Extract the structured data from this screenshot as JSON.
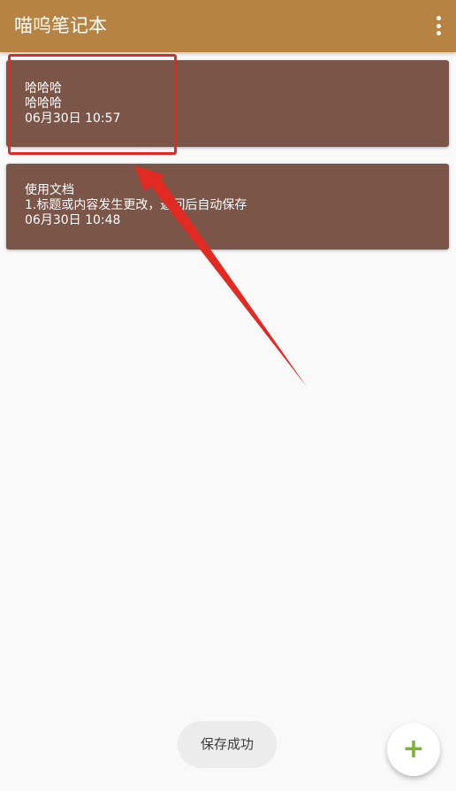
{
  "app_bar": {
    "title": "喵呜笔记本",
    "menu_icon": "more-vert-icon",
    "background": "#b68342"
  },
  "notes": [
    {
      "title": "哈哈哈",
      "content": "哈哈哈",
      "time": "06月30日 10:57"
    },
    {
      "title": "使用文档",
      "content": "1.标题或内容发生更改，返回后自动保存",
      "time": "06月30日 10:48"
    }
  ],
  "note_card_color": "#7a5548",
  "toast": {
    "text": "保存成功"
  },
  "fab": {
    "icon": "plus-icon",
    "symbol": "+",
    "color": "#7cb52b"
  },
  "annotation_color": "#e12a22"
}
